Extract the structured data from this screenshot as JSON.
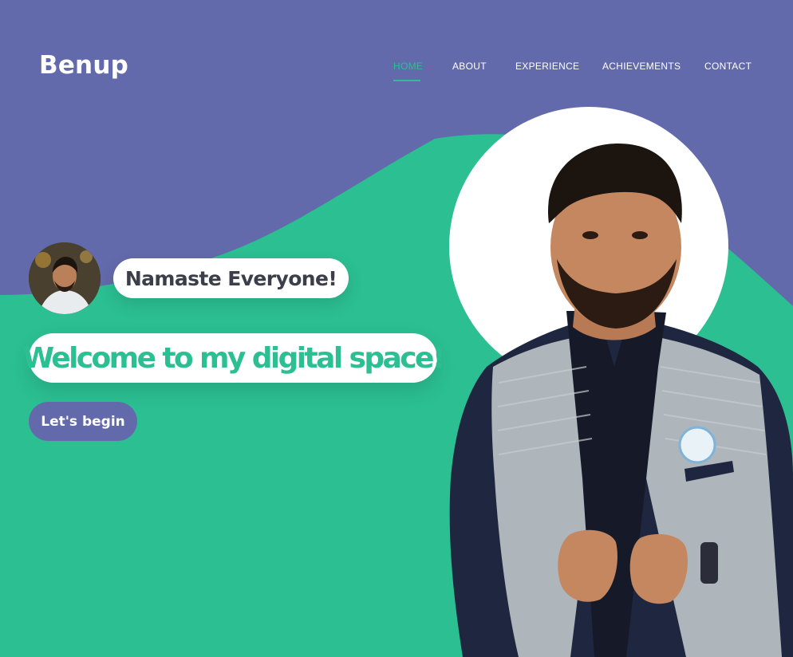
{
  "brand": {
    "name": "Benup"
  },
  "nav": {
    "items": [
      {
        "label": "HOME",
        "active": true
      },
      {
        "label": "ABOUT",
        "active": false
      },
      {
        "label": "EXPERIENCE",
        "active": false
      },
      {
        "label": "ACHIEVEMENTS",
        "active": false
      },
      {
        "label": "CONTACT",
        "active": false
      }
    ]
  },
  "hero": {
    "greeting": "Namaste Everyone!",
    "headline": "Welcome to my digital space!",
    "cta_label": "Let's begin"
  },
  "colors": {
    "primary": "#626aab",
    "accent": "#2bbf91",
    "text_dark": "#3e3e4a",
    "white": "#ffffff"
  }
}
